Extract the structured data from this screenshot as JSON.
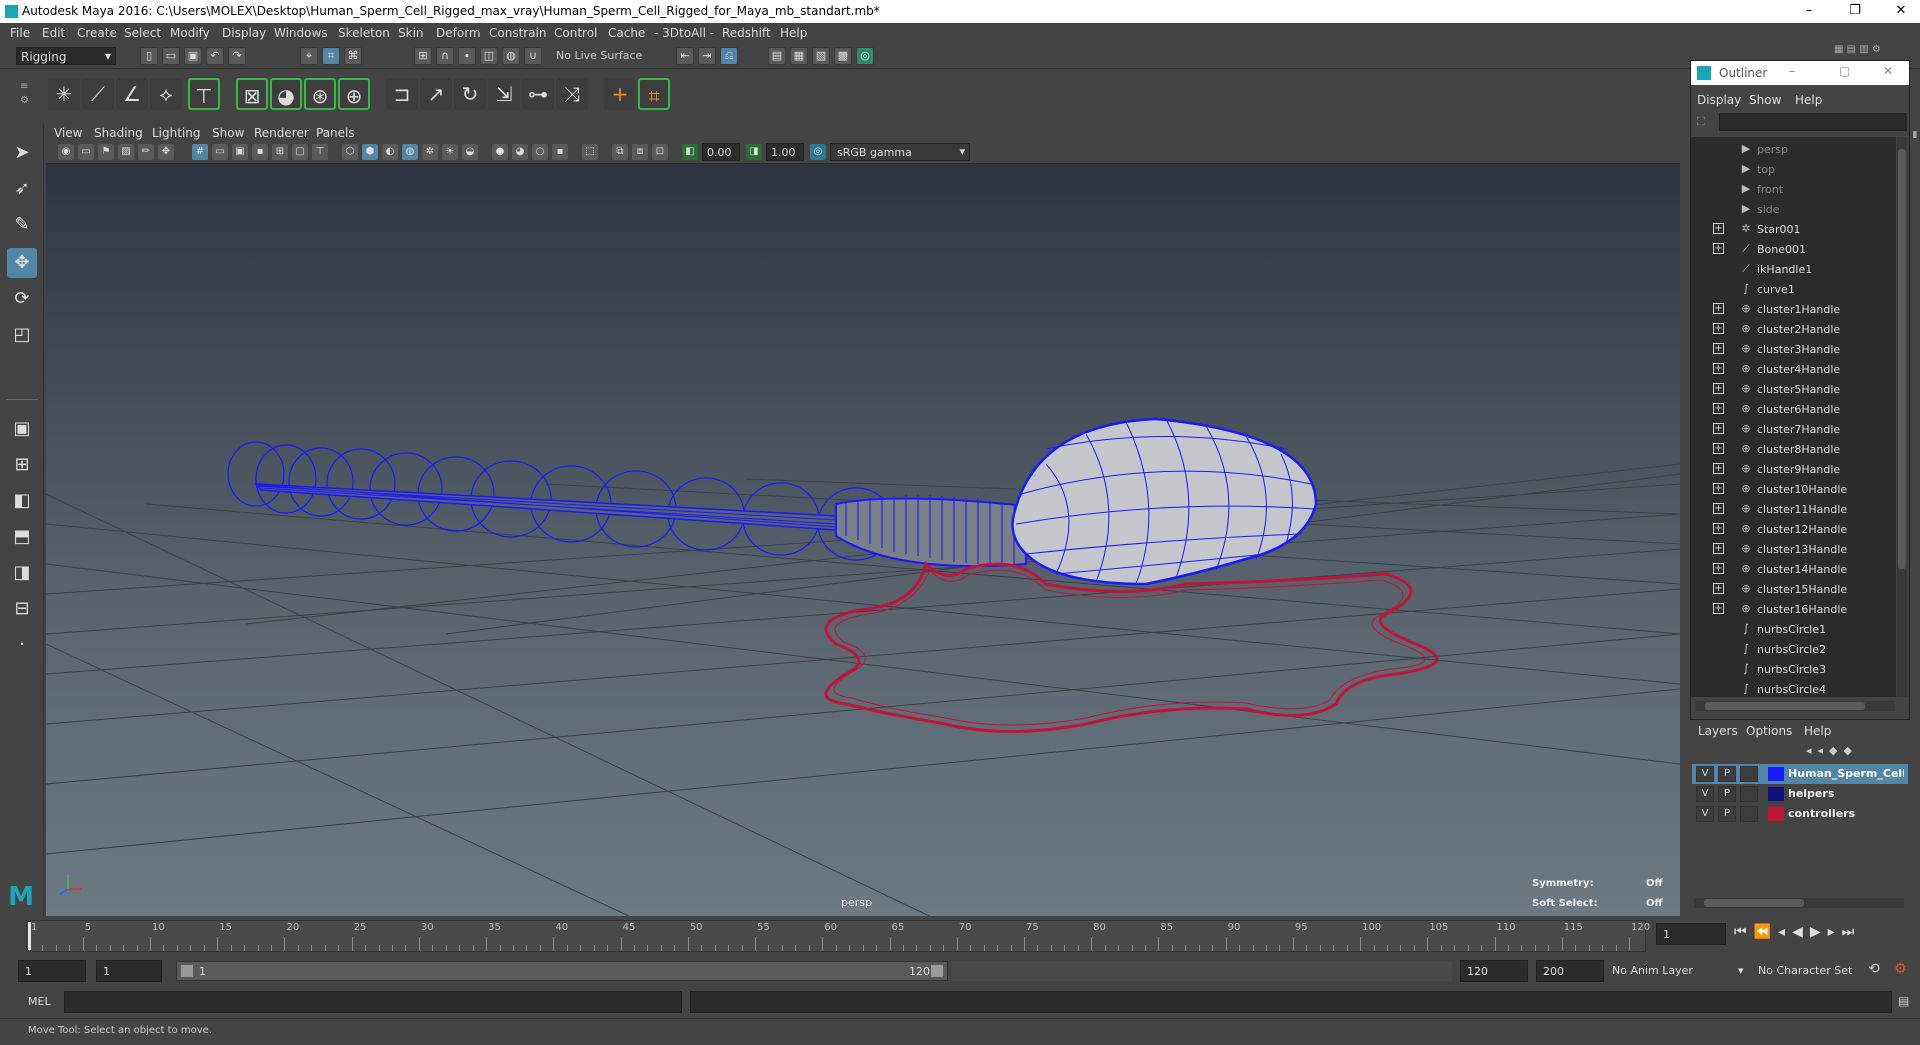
{
  "window": {
    "title": "Autodesk Maya 2016: C:\\Users\\MOLEX\\Desktop\\Human_Sperm_Cell_Rigged_max_vray\\Human_Sperm_Cell_Rigged_for_Maya_mb_standart.mb*",
    "minimize": "–",
    "restore": "❐",
    "close": "✕"
  },
  "menubar": [
    "File",
    "Edit",
    "Create",
    "Select",
    "Modify",
    "Display",
    "Windows",
    "Skeleton",
    "Skin",
    "Deform",
    "Constrain",
    "Control",
    "Cache",
    "- 3DtoAll -",
    "Redshift",
    "Help"
  ],
  "statusline": {
    "menuset": "Rigging",
    "live_surface": "No Live Surface"
  },
  "panel": {
    "menu": [
      "View",
      "Shading",
      "Lighting",
      "Show",
      "Renderer",
      "Panels"
    ],
    "exposure": "0.00",
    "gamma": "1.00",
    "colorspace": "sRGB gamma"
  },
  "viewport": {
    "camera_label": "persp",
    "symmetry_label": "Symmetry:",
    "symmetry_value": "Off",
    "soft_select_label": "Soft Select:",
    "soft_select_value": "Off"
  },
  "outliner": {
    "title": "Outliner",
    "menu": [
      "Display",
      "Show",
      "Help"
    ],
    "items": [
      {
        "label": "persp",
        "icon": "camera-icon",
        "expandable": false,
        "dim": true
      },
      {
        "label": "top",
        "icon": "camera-icon",
        "expandable": false,
        "dim": true
      },
      {
        "label": "front",
        "icon": "camera-icon",
        "expandable": false,
        "dim": true
      },
      {
        "label": "side",
        "icon": "camera-icon",
        "expandable": false,
        "dim": true
      },
      {
        "label": "Star001",
        "icon": "transform-icon",
        "expandable": true,
        "dim": false
      },
      {
        "label": "Bone001",
        "icon": "joint-icon",
        "expandable": true,
        "dim": false
      },
      {
        "label": "ikHandle1",
        "icon": "ik-handle-icon",
        "expandable": false,
        "dim": false
      },
      {
        "label": "curve1",
        "icon": "curve-icon",
        "expandable": false,
        "dim": false
      },
      {
        "label": "cluster1Handle",
        "icon": "cluster-icon",
        "expandable": true,
        "dim": false
      },
      {
        "label": "cluster2Handle",
        "icon": "cluster-icon",
        "expandable": true,
        "dim": false
      },
      {
        "label": "cluster3Handle",
        "icon": "cluster-icon",
        "expandable": true,
        "dim": false
      },
      {
        "label": "cluster4Handle",
        "icon": "cluster-icon",
        "expandable": true,
        "dim": false
      },
      {
        "label": "cluster5Handle",
        "icon": "cluster-icon",
        "expandable": true,
        "dim": false
      },
      {
        "label": "cluster6Handle",
        "icon": "cluster-icon",
        "expandable": true,
        "dim": false
      },
      {
        "label": "cluster7Handle",
        "icon": "cluster-icon",
        "expandable": true,
        "dim": false
      },
      {
        "label": "cluster8Handle",
        "icon": "cluster-icon",
        "expandable": true,
        "dim": false
      },
      {
        "label": "cluster9Handle",
        "icon": "cluster-icon",
        "expandable": true,
        "dim": false
      },
      {
        "label": "cluster10Handle",
        "icon": "cluster-icon",
        "expandable": true,
        "dim": false
      },
      {
        "label": "cluster11Handle",
        "icon": "cluster-icon",
        "expandable": true,
        "dim": false
      },
      {
        "label": "cluster12Handle",
        "icon": "cluster-icon",
        "expandable": true,
        "dim": false
      },
      {
        "label": "cluster13Handle",
        "icon": "cluster-icon",
        "expandable": true,
        "dim": false
      },
      {
        "label": "cluster14Handle",
        "icon": "cluster-icon",
        "expandable": true,
        "dim": false
      },
      {
        "label": "cluster15Handle",
        "icon": "cluster-icon",
        "expandable": true,
        "dim": false
      },
      {
        "label": "cluster16Handle",
        "icon": "cluster-icon",
        "expandable": true,
        "dim": false
      },
      {
        "label": "nurbsCircle1",
        "icon": "curve-icon",
        "expandable": false,
        "dim": false
      },
      {
        "label": "nurbsCircle2",
        "icon": "curve-icon",
        "expandable": false,
        "dim": false
      },
      {
        "label": "nurbsCircle3",
        "icon": "curve-icon",
        "expandable": false,
        "dim": false
      },
      {
        "label": "nurbsCircle4",
        "icon": "curve-icon",
        "expandable": false,
        "dim": false
      }
    ]
  },
  "layers": {
    "menu": [
      "Layers",
      "Options",
      "Help"
    ],
    "rows": [
      {
        "v": "V",
        "p": "P",
        "color": "#1a1aff",
        "name": "Human_Sperm_Cell_rig",
        "selected": true
      },
      {
        "v": "V",
        "p": "P",
        "color": "#101080",
        "name": "helpers",
        "selected": false
      },
      {
        "v": "V",
        "p": "P",
        "color": "#c0143c",
        "name": "controllers",
        "selected": false
      }
    ]
  },
  "timeline": {
    "labels": [
      "1",
      "5",
      "10",
      "15",
      "20",
      "25",
      "30",
      "35",
      "40",
      "45",
      "50",
      "55",
      "60",
      "65",
      "70",
      "75",
      "80",
      "85",
      "90",
      "95",
      "100",
      "105",
      "110",
      "115",
      "120"
    ],
    "current_frame": "1"
  },
  "range": {
    "start": "1",
    "playback_start": "1",
    "slider_start": "1",
    "slider_end": "120",
    "playback_end": "120",
    "end": "200",
    "anim_layer": "No Anim Layer",
    "character_set": "No Character Set"
  },
  "cmdline": {
    "label": "MEL"
  },
  "helpline": {
    "text": "Move Tool: Select an object to move."
  },
  "colors": {
    "accent": "#5285a6",
    "wire_blue": "#1a1aff",
    "wire_red": "#c0143c",
    "maya_teal": "#1aa6b4"
  }
}
